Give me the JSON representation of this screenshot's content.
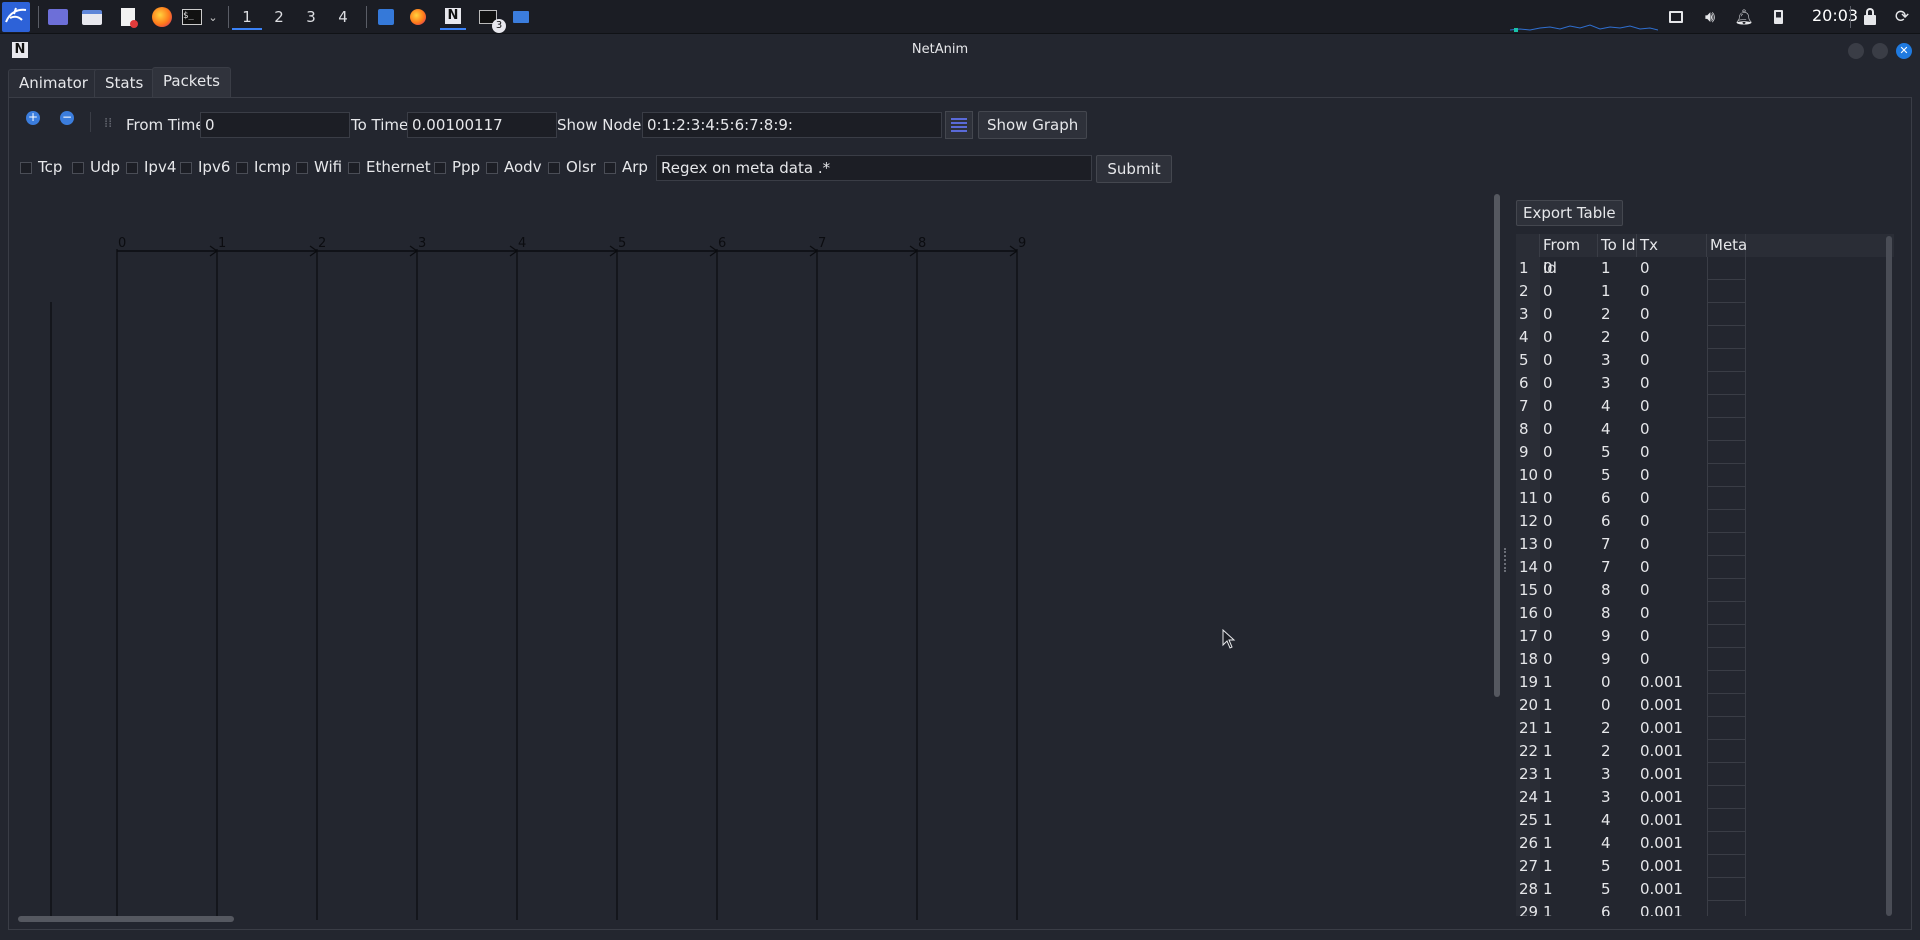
{
  "taskbar": {
    "workspaces": [
      "1",
      "2",
      "3",
      "4"
    ],
    "active_workspace": "1",
    "terminal_badge": "3",
    "clock": "20:03"
  },
  "window": {
    "title": "NetAnim",
    "accent": "#1f7ae0"
  },
  "tabs": [
    "Animator",
    "Stats",
    "Packets"
  ],
  "active_tab": "Packets",
  "toolbar": {
    "from_time_label": "From Time",
    "from_time_value": "0",
    "to_time_label": "To Time",
    "to_time_value": "0.00100117",
    "show_nodes_label": "Show Nodes",
    "show_nodes_value": "0:1:2:3:4:5:6:7:8:9:",
    "show_graph_label": "Show Graph"
  },
  "filters": {
    "protocols": [
      "Tcp",
      "Udp",
      "Ipv4",
      "Ipv6",
      "Icmp",
      "Wifi",
      "Ethernet",
      "Ppp",
      "Aodv",
      "Olsr",
      "Arp"
    ],
    "regex_label": "Regex on meta data",
    "regex_value": ".*",
    "submit_label": "Submit"
  },
  "graph": {
    "nodes": [
      "0",
      "1",
      "2",
      "3",
      "4",
      "5",
      "6",
      "7",
      "8",
      "9"
    ]
  },
  "table": {
    "export_label": "Export Table",
    "columns": [
      "From Id",
      "To Id",
      "Tx",
      "Meta"
    ],
    "rows": [
      [
        "1",
        "0",
        "1",
        "0"
      ],
      [
        "2",
        "0",
        "1",
        "0"
      ],
      [
        "3",
        "0",
        "2",
        "0"
      ],
      [
        "4",
        "0",
        "2",
        "0"
      ],
      [
        "5",
        "0",
        "3",
        "0"
      ],
      [
        "6",
        "0",
        "3",
        "0"
      ],
      [
        "7",
        "0",
        "4",
        "0"
      ],
      [
        "8",
        "0",
        "4",
        "0"
      ],
      [
        "9",
        "0",
        "5",
        "0"
      ],
      [
        "10",
        "0",
        "5",
        "0"
      ],
      [
        "11",
        "0",
        "6",
        "0"
      ],
      [
        "12",
        "0",
        "6",
        "0"
      ],
      [
        "13",
        "0",
        "7",
        "0"
      ],
      [
        "14",
        "0",
        "7",
        "0"
      ],
      [
        "15",
        "0",
        "8",
        "0"
      ],
      [
        "16",
        "0",
        "8",
        "0"
      ],
      [
        "17",
        "0",
        "9",
        "0"
      ],
      [
        "18",
        "0",
        "9",
        "0"
      ],
      [
        "19",
        "1",
        "0",
        "0.001"
      ],
      [
        "20",
        "1",
        "0",
        "0.001"
      ],
      [
        "21",
        "1",
        "2",
        "0.001"
      ],
      [
        "22",
        "1",
        "2",
        "0.001"
      ],
      [
        "23",
        "1",
        "3",
        "0.001"
      ],
      [
        "24",
        "1",
        "3",
        "0.001"
      ],
      [
        "25",
        "1",
        "4",
        "0.001"
      ],
      [
        "26",
        "1",
        "4",
        "0.001"
      ],
      [
        "27",
        "1",
        "5",
        "0.001"
      ],
      [
        "28",
        "1",
        "5",
        "0.001"
      ],
      [
        "29",
        "1",
        "6",
        "0.001"
      ]
    ]
  }
}
